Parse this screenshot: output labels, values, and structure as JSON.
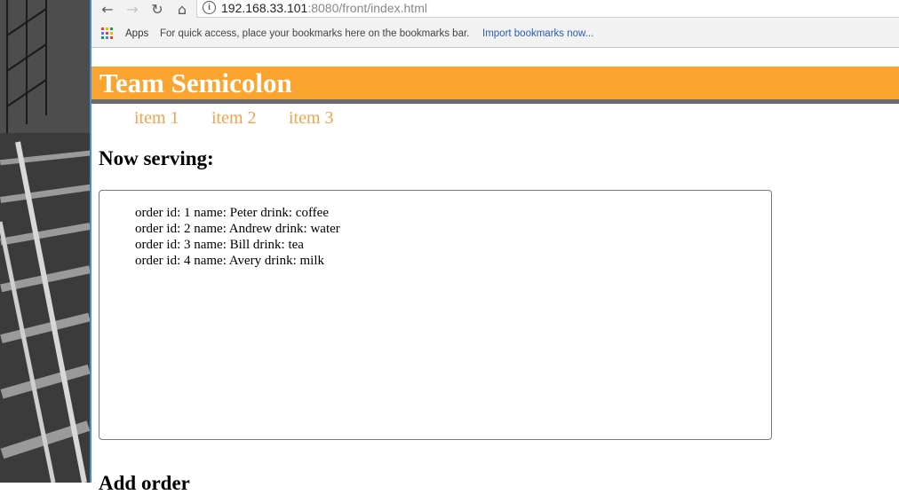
{
  "browser": {
    "url_host": "192.168.33.101",
    "url_rest": ":8080/front/index.html",
    "bookmarks_bar": {
      "apps_label": "Apps",
      "hint": "For quick access, place your bookmarks here on the bookmarks bar.",
      "import_link": "Import bookmarks now..."
    }
  },
  "colors": {
    "banner": "#fba530",
    "banner_border": "#6b6b6b",
    "menu_link": "#f6a14b",
    "bookmark_link": "#2a5db0"
  },
  "page": {
    "title": "Team Semicolon",
    "menu": [
      "item 1",
      "item 2",
      "item 3"
    ],
    "serving_heading": "Now serving:",
    "orders": [
      "order id: 1 name: Peter drink: coffee",
      "order id: 2 name: Andrew drink: water",
      "order id: 3 name: Bill drink: tea",
      "order id: 4 name: Avery drink: milk"
    ],
    "add_heading": "Add order"
  }
}
